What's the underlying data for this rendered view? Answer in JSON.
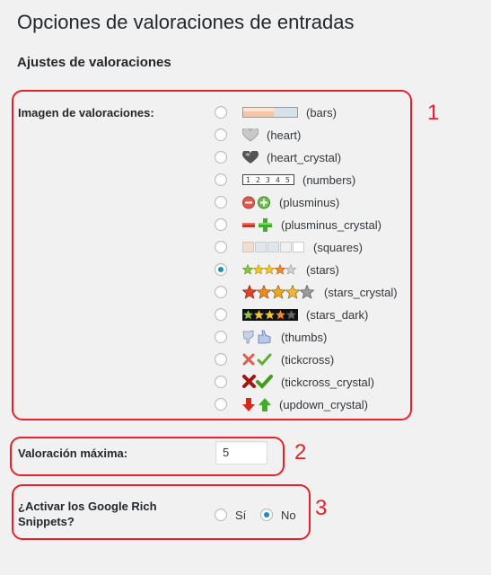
{
  "page": {
    "title": "Opciones de valoraciones de entradas",
    "section_title": "Ajustes de valoraciones"
  },
  "annotations": [
    "1",
    "2",
    "3"
  ],
  "rating_image": {
    "label": "Imagen de valoraciones:",
    "selected": "stars",
    "options": [
      {
        "label": "(bars)",
        "icon": "bars-icon"
      },
      {
        "label": "(heart)",
        "icon": "heart-icon"
      },
      {
        "label": "(heart_crystal)",
        "icon": "heart-crystal-icon"
      },
      {
        "label": "(numbers)",
        "icon": "numbers-icon"
      },
      {
        "label": "(plusminus)",
        "icon": "plusminus-icon"
      },
      {
        "label": "(plusminus_crystal)",
        "icon": "plusminus-crystal-icon"
      },
      {
        "label": "(squares)",
        "icon": "squares-icon"
      },
      {
        "label": "(stars)",
        "icon": "stars-icon"
      },
      {
        "label": "(stars_crystal)",
        "icon": "stars-crystal-icon"
      },
      {
        "label": "(stars_dark)",
        "icon": "stars-dark-icon"
      },
      {
        "label": "(thumbs)",
        "icon": "thumbs-icon"
      },
      {
        "label": "(tickcross)",
        "icon": "tickcross-icon"
      },
      {
        "label": "(tickcross_crystal)",
        "icon": "tickcross-crystal-icon"
      },
      {
        "label": "(updown_crystal)",
        "icon": "updown-crystal-icon"
      }
    ]
  },
  "max_rating": {
    "label": "Valoración máxima:",
    "value": "5"
  },
  "rich_snippets": {
    "label": "¿Activar los Google Rich Snippets?",
    "yes_label": "Sí",
    "no_label": "No",
    "selected": "no"
  },
  "colors": {
    "annotation": "#e8202a",
    "radio_checked": "#1e8cbe",
    "background": "#f1f1f1"
  }
}
